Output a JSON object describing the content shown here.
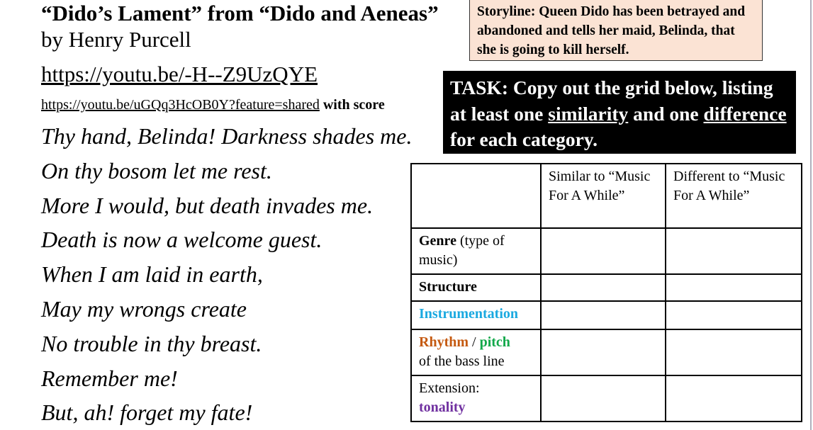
{
  "header": {
    "title": "“Dido’s Lament” from “Dido and Aeneas”",
    "subtitle": "by Henry Purcell",
    "link_main": "https://youtu.be/-H--Z9UzQYE",
    "link_score": "https://youtu.be/uGQq3HcOB0Y?feature=shared",
    "link_score_suffix": "with score"
  },
  "lyrics": [
    "Thy hand, Belinda! Darkness shades me.",
    "On thy bosom let me rest.",
    "More I would, but death invades me.",
    "Death is now a welcome guest.",
    "When I am laid in earth,",
    "May my wrongs create",
    "No trouble in thy breast.",
    "Remember me!",
    "But, ah! forget my fate!"
  ],
  "storyline": {
    "text": "Storyline: Queen Dido has been betrayed and abandoned and tells her maid, Belinda, that she is going to kill herself.",
    "background": "#fbe3d4"
  },
  "task": {
    "part1": "TASK: Copy out the grid below, listing at least one ",
    "similarity": "similarity",
    "part2": " and one ",
    "difference": "difference",
    "part3": " for each category."
  },
  "grid": {
    "headers": [
      "",
      "Similar to “Music For A While”",
      "Different to “Music For A While”"
    ],
    "rows": {
      "genre": {
        "bold": "Genre",
        "rest": " (type of music)"
      },
      "structure": {
        "bold": "Structure"
      },
      "instrumentation": {
        "label": "Instrumentation",
        "color": "#1aa9e0"
      },
      "rhythm_pitch": {
        "rhythm": "Rhythm",
        "sep": " / ",
        "pitch": "pitch",
        "rest": "of the bass line",
        "rhythm_color": "#c55a11",
        "pitch_color": "#12a84a"
      },
      "extension": {
        "prefix": "Extension:",
        "tonality": "tonality",
        "tonality_color": "#7030a0"
      }
    }
  }
}
